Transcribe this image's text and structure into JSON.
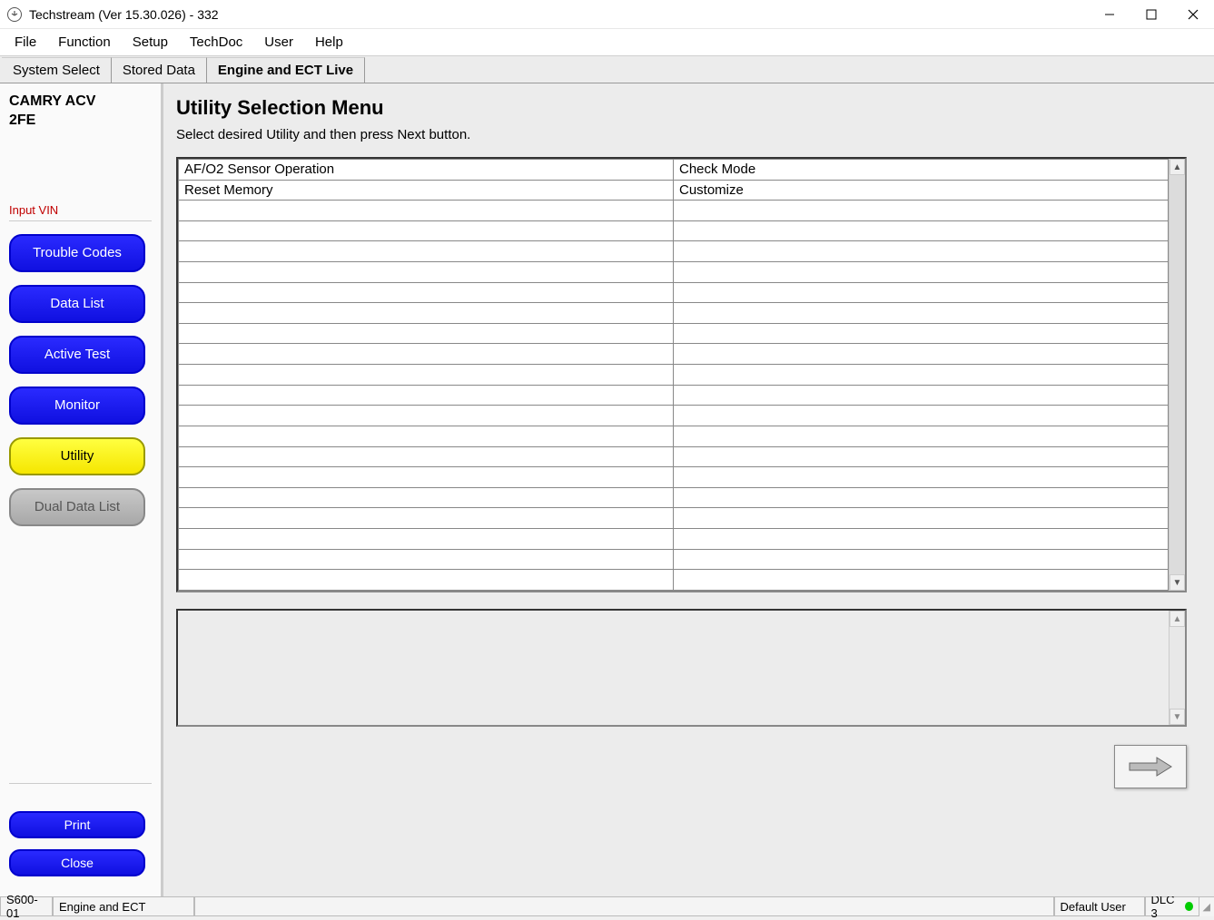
{
  "window": {
    "title": "Techstream (Ver 15.30.026) - 332"
  },
  "menu": {
    "items": [
      "File",
      "Function",
      "Setup",
      "TechDoc",
      "User",
      "Help"
    ]
  },
  "tabs": {
    "items": [
      {
        "label": "System Select",
        "active": false
      },
      {
        "label": "Stored Data",
        "active": false
      },
      {
        "label": "Engine and ECT Live",
        "active": true
      }
    ]
  },
  "sidebar": {
    "vehicle_line1": "CAMRY ACV",
    "vehicle_line2": "2FE",
    "input_vin": "Input VIN",
    "buttons": {
      "trouble_codes": "Trouble Codes",
      "data_list": "Data List",
      "active_test": "Active Test",
      "monitor": "Monitor",
      "utility": "Utility",
      "dual_data_list": "Dual Data List"
    },
    "print": "Print",
    "close": "Close"
  },
  "main": {
    "title": "Utility Selection Menu",
    "subtitle": "Select desired Utility and then press Next button.",
    "utilities": {
      "r0c0": "AF/O2 Sensor Operation",
      "r0c1": "Check Mode",
      "r1c0": "Reset Memory",
      "r1c1": "Customize"
    }
  },
  "statusbar": {
    "code": "S600-01",
    "system": "Engine and ECT",
    "user": "Default User",
    "dlc": "DLC 3"
  }
}
